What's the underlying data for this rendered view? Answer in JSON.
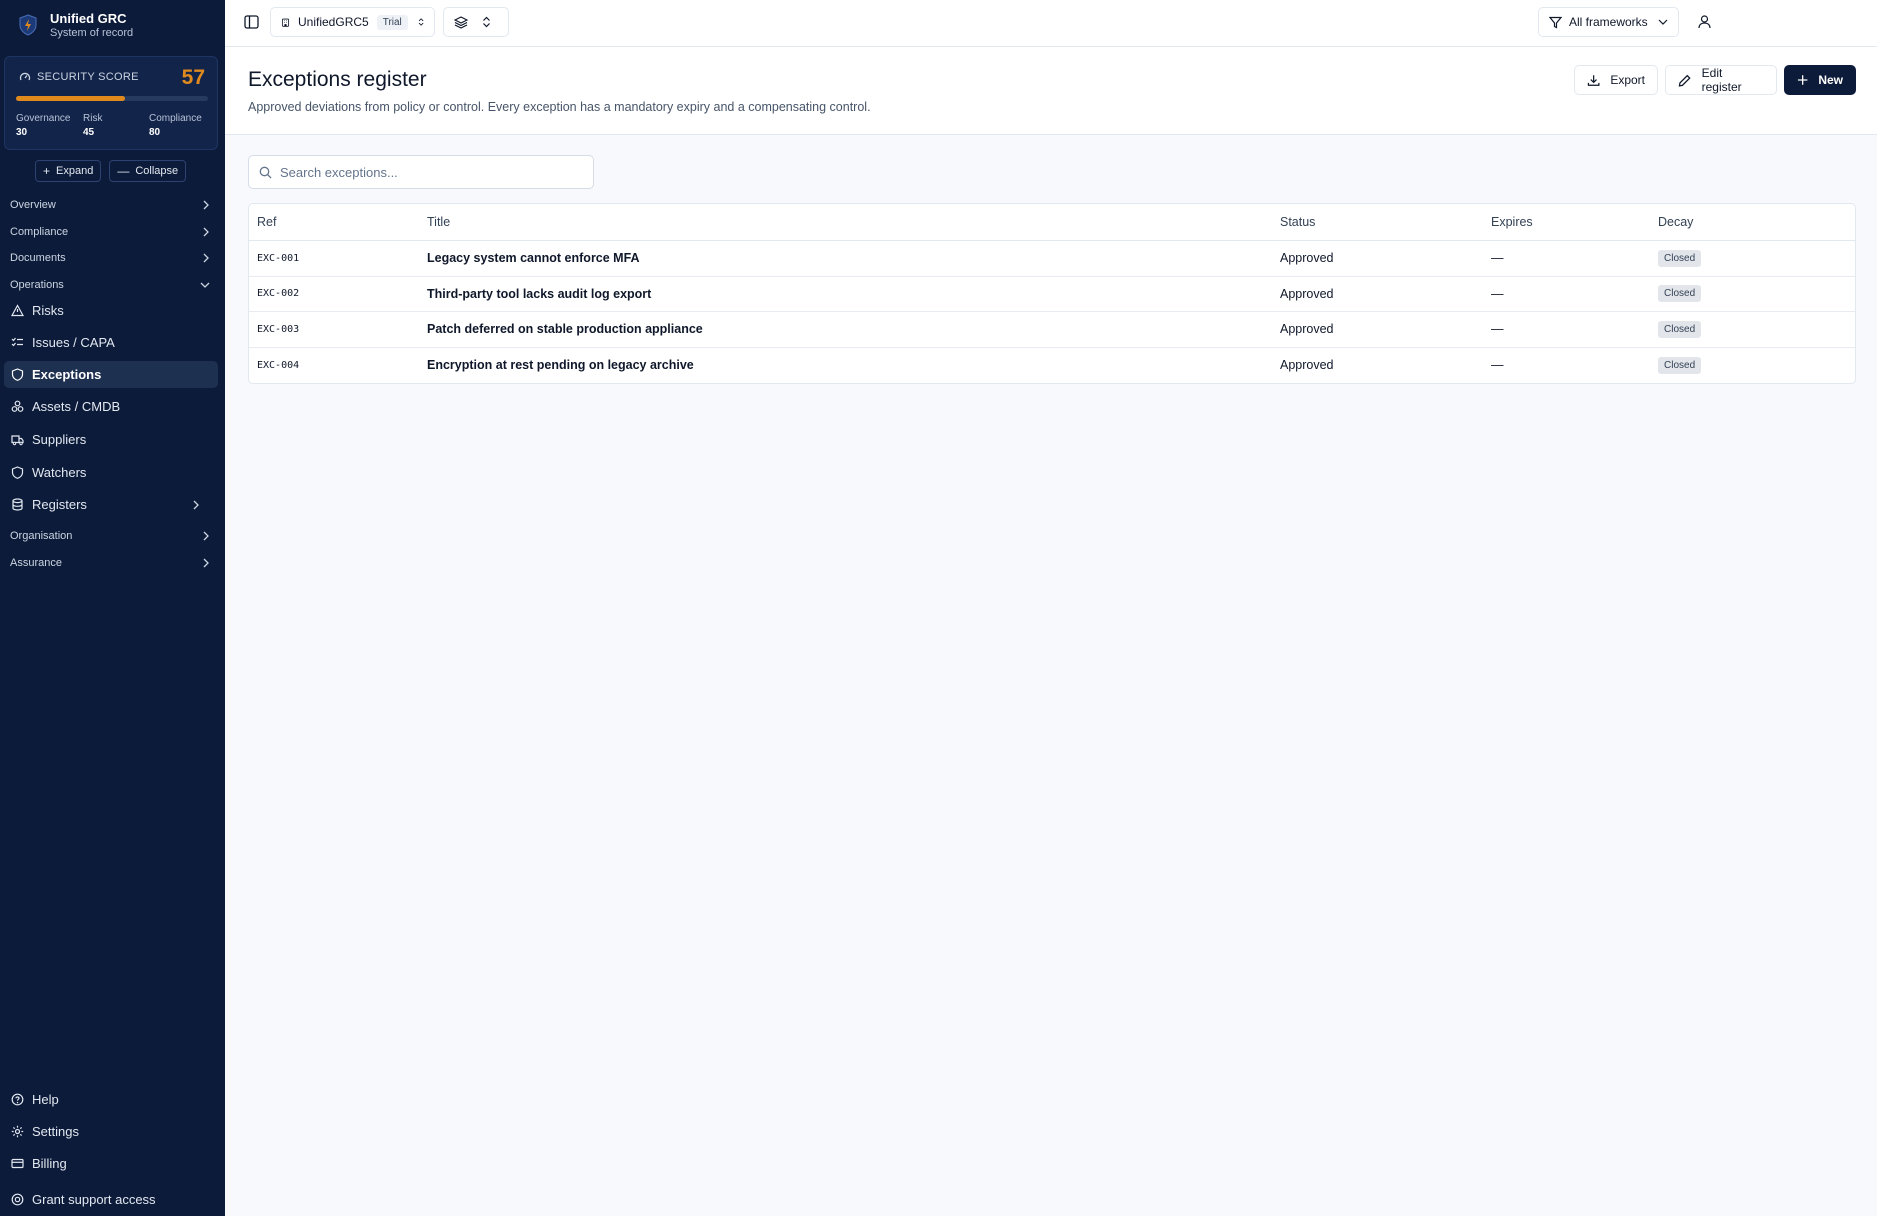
{
  "app": {
    "name": "Unified GRC",
    "subtitle": "System of record"
  },
  "security_score": {
    "label": "SECURITY SCORE",
    "value": "57",
    "level": 0.57,
    "metrics": [
      {
        "label": "Governance",
        "value": "30"
      },
      {
        "label": "Risk",
        "value": "45"
      },
      {
        "label": "Compliance",
        "value": "80"
      }
    ],
    "accent_color": "#e08a1e"
  },
  "sidebar_controls": {
    "expand": "Expand",
    "collapse": "Collapse"
  },
  "sidebar": {
    "sections": [
      "Overview",
      "Compliance",
      "Documents",
      "Operations",
      "Organisation",
      "Assurance"
    ],
    "items": [
      "Risks",
      "Issues / CAPA",
      "Exceptions",
      "Assets / CMDB",
      "Suppliers",
      "Watchers",
      "Registers"
    ],
    "active": "Exceptions",
    "footer": [
      "Help",
      "Settings",
      "Billing",
      "Grant support access"
    ]
  },
  "topbar": {
    "workspace": "UnifiedGRC5",
    "plan_badge": "Trial",
    "filter": "All frameworks"
  },
  "page": {
    "title": "Exceptions register",
    "description": "Approved deviations from policy or control. Every exception has a mandatory expiry and a compensating control.",
    "actions": {
      "export": "Export",
      "edit": "Edit register",
      "new": "New"
    }
  },
  "search": {
    "placeholder": "Search exceptions..."
  },
  "table": {
    "columns": [
      "Ref",
      "Title",
      "Status",
      "Expires",
      "Decay"
    ],
    "rows": [
      {
        "ref": "EXC-001",
        "title": "Legacy system cannot enforce MFA",
        "status": "Approved",
        "expires": "—",
        "decay": "Closed"
      },
      {
        "ref": "EXC-002",
        "title": "Third-party tool lacks audit log export",
        "status": "Approved",
        "expires": "—",
        "decay": "Closed"
      },
      {
        "ref": "EXC-003",
        "title": "Patch deferred on stable production appliance",
        "status": "Approved",
        "expires": "—",
        "decay": "Closed"
      },
      {
        "ref": "EXC-004",
        "title": "Encryption at rest pending on legacy archive",
        "status": "Approved",
        "expires": "—",
        "decay": "Closed"
      }
    ]
  }
}
